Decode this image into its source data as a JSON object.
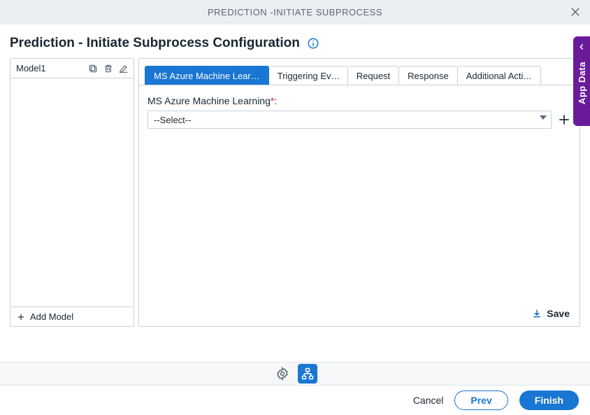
{
  "topbar": {
    "title": "PREDICTION -INITIATE SUBPROCESS"
  },
  "page": {
    "title": "Prediction - Initiate Subprocess Configuration"
  },
  "sidebar": {
    "models": [
      "Model1"
    ],
    "add_label": "Add Model"
  },
  "tabs": [
    "MS Azure Machine Lear…",
    "Triggering Ev…",
    "Request",
    "Response",
    "Additional Acti…"
  ],
  "form": {
    "ml_label": "MS Azure Machine Learning",
    "ml_colon": ":",
    "select_placeholder": "--Select--"
  },
  "save_label": "Save",
  "footer": {
    "cancel": "Cancel",
    "prev": "Prev",
    "finish": "Finish"
  },
  "side_tab": "App Data"
}
